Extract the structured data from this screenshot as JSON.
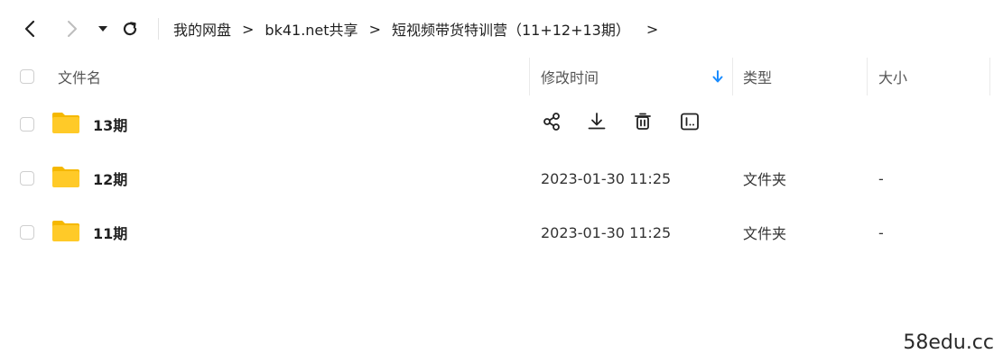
{
  "toolbar": {
    "back_icon": "chevron-left-icon",
    "forward_icon": "chevron-right-icon",
    "history_icon": "caret-down-icon",
    "refresh_icon": "refresh-icon"
  },
  "breadcrumb": {
    "items": [
      "我的网盘",
      "bk41.net共享",
      "短视频带货特训营（11+12+13期）"
    ],
    "separator": ">"
  },
  "table": {
    "columns": {
      "name": "文件名",
      "modified": "修改时间",
      "type": "类型",
      "size": "大小"
    },
    "sort_icon": "arrow-down-icon",
    "rows": [
      {
        "name": "13期",
        "modified": "",
        "type": "",
        "size": "",
        "hovered": true,
        "actions": [
          "share-icon",
          "download-icon",
          "delete-icon",
          "more-icon"
        ]
      },
      {
        "name": "12期",
        "modified": "2023-01-30 11:25",
        "type": "文件夹",
        "size": "-"
      },
      {
        "name": "11期",
        "modified": "2023-01-30 11:25",
        "type": "文件夹",
        "size": "-"
      }
    ]
  },
  "watermark": "58edu.cc",
  "colors": {
    "folder": "#FFCA28",
    "folder_back": "#F5B800",
    "accent": "#1a8cff"
  }
}
